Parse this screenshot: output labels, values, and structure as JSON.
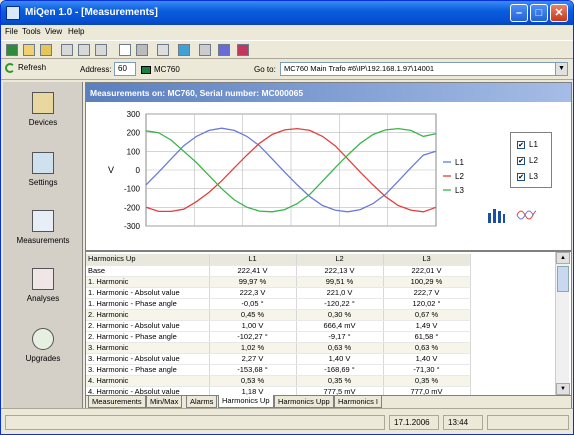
{
  "window": {
    "title": "MiQen 1.0 - [Measurements]"
  },
  "menu": [
    "File",
    "Tools",
    "View",
    "Help"
  ],
  "toolbar": {
    "refresh_label": "Refresh",
    "address_label": "Address:",
    "address_value": "60",
    "device": "MC760",
    "goto_label": "Go to:",
    "goto_value": "MC760 Main Trafo #6\\IP\\192.168.1.97\\14001"
  },
  "sidebar": {
    "items": [
      {
        "label": "Devices",
        "icon": "devices-icon"
      },
      {
        "label": "Settings",
        "icon": "settings-icon"
      },
      {
        "label": "Measurements",
        "icon": "measurements-icon"
      },
      {
        "label": "Analyses",
        "icon": "analyses-icon"
      },
      {
        "label": "Upgrades",
        "icon": "upgrades-icon"
      }
    ]
  },
  "content": {
    "header": "Measurements on: MC760, Serial number: MC000065"
  },
  "chart_data": {
    "type": "line",
    "ylabel": "V",
    "ylim": [
      -300,
      300
    ],
    "yticks": [
      300,
      200,
      100,
      0,
      -100,
      -200,
      -300
    ],
    "grid": true,
    "legend_position": "right",
    "colors": {
      "L1": "#6a7bd6",
      "L2": "#e0413d",
      "L3": "#3ab54a"
    },
    "series": [
      {
        "name": "L1",
        "values": [
          -80,
          -12,
          60,
          130,
          180,
          212,
          224,
          212,
          180,
          130,
          60,
          -12,
          -80,
          -143,
          -190,
          -215,
          -224,
          -212,
          -180,
          -130,
          -60,
          12,
          80,
          100
        ]
      },
      {
        "name": "L2",
        "values": [
          -200,
          -222,
          -222,
          -210,
          -170,
          -120,
          -58,
          12,
          80,
          143,
          190,
          215,
          222,
          212,
          180,
          130,
          60,
          -12,
          -80,
          -143,
          -190,
          -215,
          -224,
          -200
        ]
      },
      {
        "name": "L3",
        "values": [
          210,
          200,
          160,
          100,
          40,
          -30,
          -100,
          -160,
          -200,
          -220,
          -224,
          -212,
          -180,
          -130,
          -60,
          12,
          80,
          143,
          190,
          215,
          222,
          212,
          180,
          195
        ]
      }
    ],
    "legend": [
      "L1",
      "L2",
      "L3"
    ]
  },
  "legend_checkboxes": [
    {
      "label": "L1",
      "checked": true
    },
    {
      "label": "L2",
      "checked": true
    },
    {
      "label": "L3",
      "checked": true
    }
  ],
  "table": {
    "headers": [
      "Harmonics Up",
      "L1",
      "L2",
      "L3"
    ],
    "rows": [
      [
        "Base",
        "222,41  V",
        "222,13  V",
        "222,01  V"
      ],
      [
        "1. Harmonic",
        "99,97 %",
        "99,51 %",
        "100,29 %"
      ],
      [
        "1. Harmonic - Absolut value",
        "222,3 V",
        "221,0 V",
        "222,7 V"
      ],
      [
        "1. Harmonic - Phase angle",
        "-0,05 °",
        "-120,22 °",
        "120,02 °"
      ],
      [
        "2. Harmonic",
        "0,45 %",
        "0,30 %",
        "0,67 %"
      ],
      [
        "2. Harmonic - Absolut value",
        "1,00 V",
        "666,4 mV",
        "1,49 V"
      ],
      [
        "2. Harmonic - Phase angle",
        "-102,27 °",
        "-9,17 °",
        "61,58 °"
      ],
      [
        "3. Harmonic",
        "1,02 %",
        "0,63 %",
        "0,63 %"
      ],
      [
        "3. Harmonic - Absolut value",
        "2,27 V",
        "1,40 V",
        "1,40 V"
      ],
      [
        "3. Harmonic - Phase angle",
        "-153,68 °",
        "-168,69 °",
        "-71,30 °"
      ],
      [
        "4. Harmonic",
        "0,53 %",
        "0,35 %",
        "0,35 %"
      ],
      [
        "4. Harmonic - Absolut value",
        "1,18 V",
        "777,5 mV",
        "777,0 mV"
      ]
    ]
  },
  "tabs": [
    "Measurements",
    "Min/Max",
    "Alarms",
    "Harmonics Up",
    "Harmonics Upp",
    "Harmonics I"
  ],
  "active_tab": "Harmonics Up",
  "status": {
    "date": "17.1.2006",
    "time": "13:44"
  }
}
